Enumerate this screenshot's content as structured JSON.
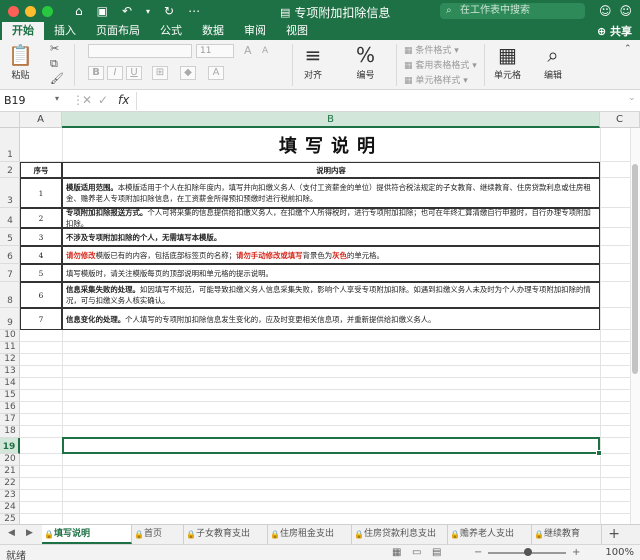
{
  "window": {
    "title": "专项附加扣除信息",
    "search_placeholder": "在工作表中搜索"
  },
  "tabs": [
    "开始",
    "插入",
    "页面布局",
    "公式",
    "数据",
    "审阅",
    "视图"
  ],
  "share_label": "共享",
  "ribbon": {
    "paste_label": "粘贴",
    "font_name": "",
    "font_size": "11",
    "align_label": "对齐",
    "number_label": "编号",
    "conditional_format": "条件格式",
    "table_format": "套用表格格式",
    "cell_styles": "单元格样式",
    "cells_label": "单元格",
    "edit_label": "编辑"
  },
  "formula_bar": {
    "name_box": "B19",
    "fx": "fx",
    "value": ""
  },
  "columns": [
    "A",
    "B",
    "C"
  ],
  "rows": [
    "1",
    "2",
    "3",
    "4",
    "5",
    "6",
    "7",
    "8",
    "9",
    "10",
    "11",
    "12",
    "13",
    "14",
    "15",
    "16",
    "17",
    "18",
    "19",
    "20",
    "21",
    "22",
    "23",
    "24",
    "25",
    "26",
    "27",
    "28",
    "29"
  ],
  "sheet": {
    "title": "填写说明",
    "header_num": "序号",
    "header_content": "说明内容",
    "items": [
      {
        "num": "1",
        "bold": "模版适用范围。",
        "text": "本模版适用于个人在扣除年度内，填写并向扣缴义务人（支付工资薪金的单位）提供符合税法规定的子女教育、继续教育、住房贷款利息或住房租金、赡养老人专项附加扣除信息，在工资薪金所得预扣预缴时进行税前扣除。"
      },
      {
        "num": "2",
        "bold": "专项附加扣除报送方式。",
        "text": "个人可将采集的信息提供给扣缴义务人，在扣缴个人所得税时，进行专项附加扣除；也可在年终汇算清缴自行申报时，自行办理专项附加扣除。"
      },
      {
        "num": "3",
        "bold": "不涉及专项附加扣除的个人，无需填写本模版。",
        "text": ""
      },
      {
        "num": "4",
        "red1": "请勿修改",
        "text_a": "模版已有的内容，包括底部标签页的名称；",
        "red2": "请勿手动修改或填写",
        "text_b": "背景色为",
        "red3": "灰色",
        "text_c": "的单元格。"
      },
      {
        "num": "5",
        "text": "填写模版时，请关注模版每页的顶部说明和单元格的提示说明。"
      },
      {
        "num": "6",
        "bold": "信息采集失败的处理。",
        "text": "如因填写不规范，可能导致扣缴义务人信息采集失败，影响个人享受专项附加扣除。如遇到扣缴义务人未及时为个人办理专项附加扣除的情况，可与扣缴义务人核实确认。"
      },
      {
        "num": "7",
        "bold": "信息变化的处理。",
        "text": "个人填写的专项附加扣除信息发生变化的，应及时变更相关信息项，并重新提供给扣缴义务人。"
      }
    ]
  },
  "sheet_tabs": [
    "填写说明",
    "首页",
    "子女教育支出",
    "住房租金支出",
    "住房贷款利息支出",
    "赡养老人支出",
    "继续教育"
  ],
  "status": {
    "text": "就绪",
    "zoom": "100%"
  },
  "colors": {
    "accent": "#1e7145",
    "warning_red": "#d62b1f"
  }
}
